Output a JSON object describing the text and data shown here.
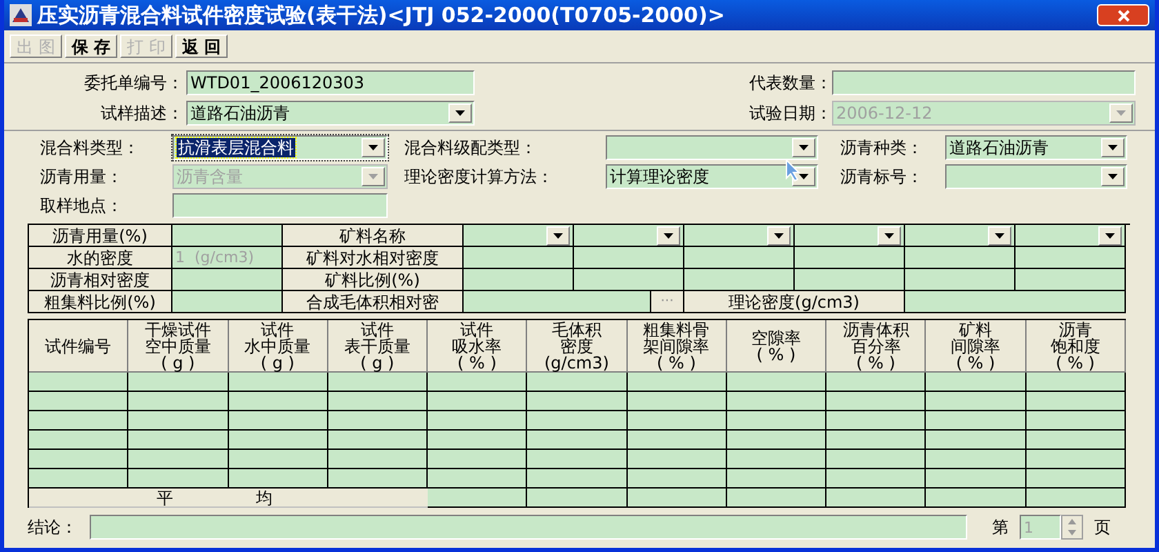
{
  "window": {
    "title": "压实沥青混合料试件密度试验(表干法)<JTJ 052-2000(T0705-2000)>"
  },
  "toolbar": [
    {
      "label": "出 图",
      "disabled": true
    },
    {
      "label": "保 存",
      "disabled": false
    },
    {
      "label": "打 印",
      "disabled": true
    },
    {
      "label": "返 回",
      "disabled": false
    }
  ],
  "top_left": [
    {
      "label": "委托单编号：",
      "value": "WTD01_2006120303",
      "kind": "text",
      "disabled": false
    },
    {
      "label": "试样描述：",
      "value": "道路石油沥青",
      "kind": "combo",
      "disabled": false
    }
  ],
  "top_right": [
    {
      "label": "代表数量：",
      "kind": "text",
      "disabled": false
    },
    {
      "label": "试验日期：",
      "value": "2006-12-12",
      "kind": "combo",
      "disabled": true
    }
  ],
  "mix_rows": [
    [
      {
        "label": "混合料类型：",
        "value": "抗滑表层混合料",
        "kind": "combo",
        "disabled": false,
        "selected": true
      },
      {
        "label": "混合料级配类型：",
        "kind": "combo",
        "disabled": false,
        "selected": false
      },
      {
        "label": "沥青种类：",
        "value": "道路石油沥青",
        "kind": "combo",
        "disabled": false,
        "selected": false
      }
    ],
    [
      {
        "label": "沥青用量：",
        "value": "沥青含量",
        "kind": "combo",
        "disabled": true,
        "selected": false
      },
      {
        "label": "理论密度计算方法：",
        "value": "计算理论密度",
        "kind": "combo",
        "disabled": false,
        "selected": false
      },
      {
        "label": "沥青标号：",
        "kind": "combo",
        "disabled": false,
        "selected": false
      }
    ],
    [
      {
        "label": "取样地点：",
        "kind": "text",
        "disabled": false,
        "selected": false
      }
    ]
  ],
  "props": [
    {
      "label": "沥青用量(%)",
      "mid_label": "矿料名称",
      "kind": "combos"
    },
    {
      "label": "水的密度",
      "value": "1  (g/cm3)",
      "value_disabled": true,
      "mid_label": "矿料对水相对密度",
      "kind": "cells"
    },
    {
      "label": "沥青相对密度",
      "mid_label": "矿料比例(%)",
      "kind": "cells"
    },
    {
      "label": "粗集料比例(%)",
      "mid_label": "合成毛体积相对密",
      "kind": "theory",
      "button": "···",
      "theory_label": "理论密度(g/cm3)"
    }
  ],
  "table": {
    "columns": [
      [
        "试件编号"
      ],
      [
        "干燥试件",
        "空中质量",
        "( g )"
      ],
      [
        "试件",
        "水中质量",
        "( g )"
      ],
      [
        "试件",
        "表干质量",
        "( g )"
      ],
      [
        "试件",
        "吸水率",
        "( % )"
      ],
      [
        "毛体积",
        "密度",
        "(g/cm3)"
      ],
      [
        "粗集料骨",
        "架间隙率",
        "( % )"
      ],
      [
        "空隙率",
        "( % )"
      ],
      [
        "沥青体积",
        "百分率",
        "( % )"
      ],
      [
        "矿料",
        "间隙率",
        "( % )"
      ],
      [
        "沥青",
        "饱和度",
        "( % )"
      ]
    ],
    "rows": [
      {
        "kind": "empty"
      },
      {
        "kind": "empty"
      },
      {
        "kind": "empty"
      },
      {
        "kind": "empty"
      },
      {
        "kind": "empty"
      },
      {
        "kind": "empty"
      }
    ],
    "average_label": [
      "平",
      "均"
    ]
  },
  "footer": {
    "conclusion_label": "结论：",
    "page_prefix": "第",
    "page": "1",
    "page_suffix": "页"
  }
}
